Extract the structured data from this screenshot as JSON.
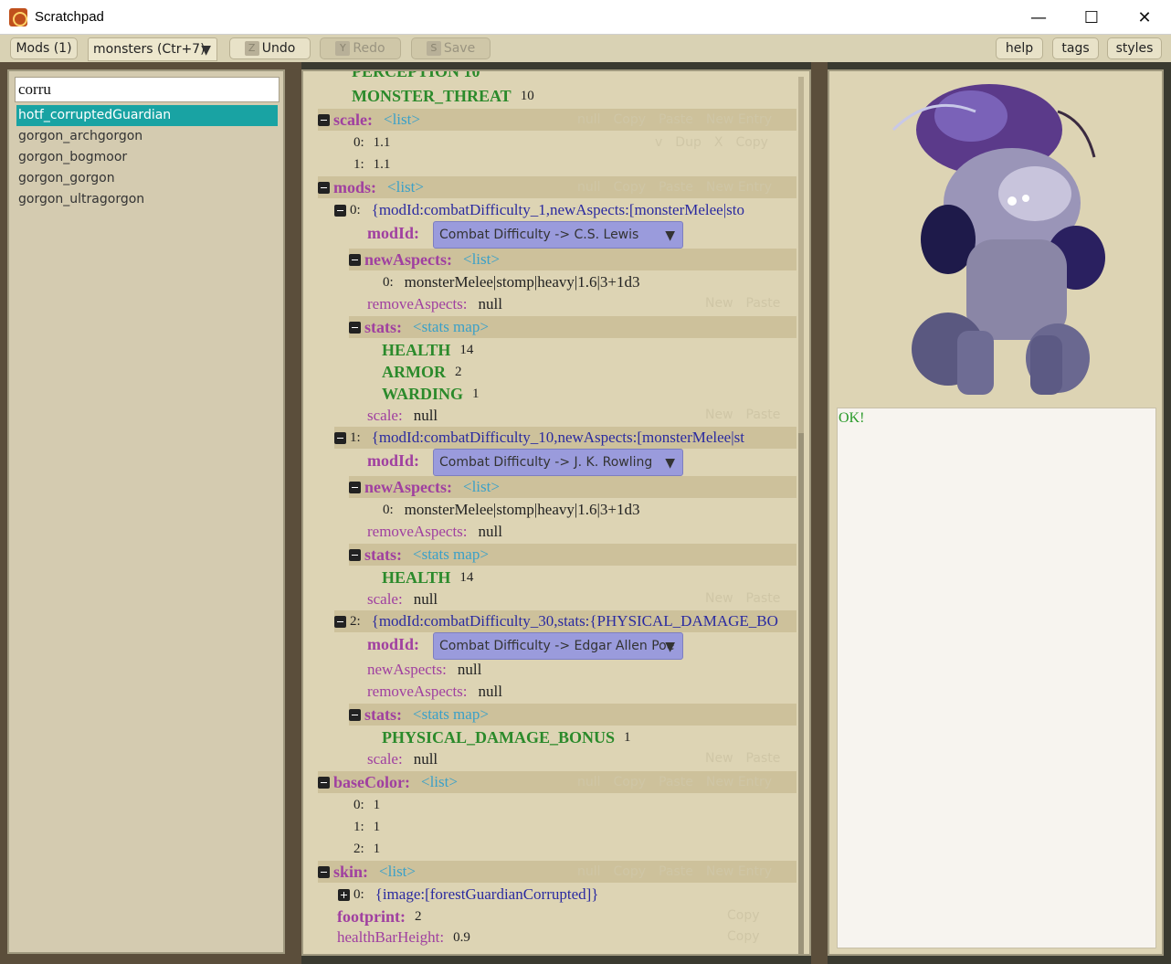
{
  "window": {
    "title": "Scratchpad",
    "minimize": "—",
    "maximize": "☐",
    "close": "✕"
  },
  "toolbar": {
    "mods": "Mods (1)",
    "file_dropdown": "monsters (Ctr+7)",
    "undo_key": "Z",
    "undo": "Undo",
    "redo_key": "Y",
    "redo": "Redo",
    "save_key": "S",
    "save": "Save",
    "help": "help",
    "tags": "tags",
    "styles": "styles"
  },
  "search": {
    "value": "corru"
  },
  "results": [
    "hotf_corruptedGuardian",
    "gorgon_archgorgon",
    "gorgon_bogmoor",
    "gorgon_gorgon",
    "gorgon_ultragorgon"
  ],
  "editor": {
    "cut_top": "PERCEPTION 10",
    "monster_threat_key": "MONSTER_THREAT",
    "monster_threat_val": "10",
    "scale_key": "scale:",
    "scale_type": "<list>",
    "scale_0_idx": "0:",
    "scale_0_val": "1.1",
    "scale_1_idx": "1:",
    "scale_1_val": "1.1",
    "mods_key": "mods:",
    "mods_type": "<list>",
    "m0_idx": "0:",
    "m0_summary": "{modId:combatDifficulty_1,newAspects:[monsterMelee|sto",
    "modid_key": "modId:",
    "m0_modid": "Combat Difficulty -> C.S. Lewis",
    "newaspects_key": "newAspects:",
    "list_type": "<list>",
    "m0_na0_idx": "0:",
    "m0_na0_val": "monsterMelee|stomp|heavy|1.6|3+1d3",
    "removeaspects_key": "removeAspects:",
    "null": "null",
    "stats_key": "stats:",
    "stats_type": "<stats map>",
    "health_key": "HEALTH",
    "m0_health": "14",
    "armor_key": "ARMOR",
    "m0_armor": "2",
    "warding_key": "WARDING",
    "m0_warding": "1",
    "scale_sub_key": "scale:",
    "m1_idx": "1:",
    "m1_summary": "{modId:combatDifficulty_10,newAspects:[monsterMelee|st",
    "m1_modid": "Combat Difficulty -> J. K. Rowling",
    "m1_na0_idx": "0:",
    "m1_na0_val": "monsterMelee|stomp|heavy|1.6|3+1d3",
    "m1_health": "14",
    "m2_idx": "2:",
    "m2_summary": "{modId:combatDifficulty_30,stats:{PHYSICAL_DAMAGE_BO",
    "m2_modid": "Combat Difficulty -> Edgar Allen Poe",
    "pdb_key": "PHYSICAL_DAMAGE_BONUS",
    "m2_pdb": "1",
    "basecolor_key": "baseColor:",
    "bc_0_idx": "0:",
    "bc_0_val": "1",
    "bc_1_idx": "1:",
    "bc_1_val": "1",
    "bc_2_idx": "2:",
    "bc_2_val": "1",
    "skin_key": "skin:",
    "skin_0_idx": "0:",
    "skin_0_val": "{image:[forestGuardianCorrupted]}",
    "footprint_key": "footprint:",
    "footprint_val": "2",
    "healthbar_key": "healthBarHeight:",
    "healthbar_val": "0.9",
    "ghost": {
      "null": "null",
      "copy": "Copy",
      "paste": "Paste",
      "new_entry": "New Entry",
      "new": "New",
      "x": "X",
      "dup": "Dup",
      "v": "v",
      "caret": "^"
    }
  },
  "console": {
    "text": "OK!"
  }
}
